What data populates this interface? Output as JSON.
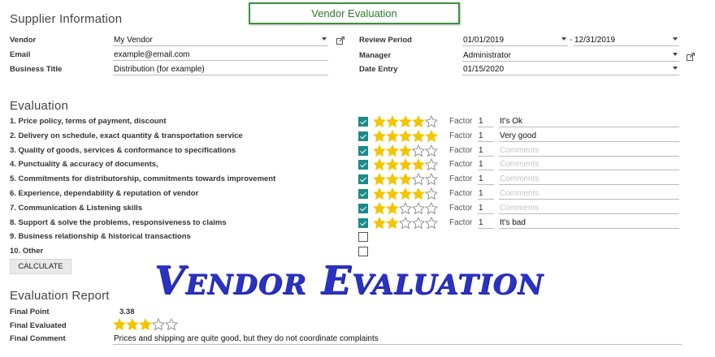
{
  "header": {
    "vendor_evaluation_button": "Vendor Evaluation"
  },
  "supplier": {
    "title": "Supplier Information",
    "vendor_label": "Vendor",
    "vendor_value": "My Vendor",
    "email_label": "Email",
    "email_value": "example@email.com",
    "business_title_label": "Business Title",
    "business_title_value": "Distribution (for example)"
  },
  "period": {
    "review_period_label": "Review Period",
    "start": "01/01/2019",
    "separator": "-",
    "end": "12/31/2019",
    "manager_label": "Manager",
    "manager_value": "Administrator",
    "date_entry_label": "Date Entry",
    "date_entry_value": "01/15/2020"
  },
  "evaluation": {
    "title": "Evaluation",
    "factor_label": "Factor",
    "max_stars": 5,
    "colors": {
      "star_filled": "#f2c500",
      "star_empty": "#888888",
      "checkbox": "#1c8a8a"
    },
    "criteria": [
      {
        "label": "1. Price policy, terms of payment, discount",
        "checked": true,
        "stars": 4,
        "factor": "1",
        "comment": "It's Ok",
        "placeholder": ""
      },
      {
        "label": "2. Delivery on schedule, exact quantity & transportation service",
        "checked": true,
        "stars": 5,
        "factor": "1",
        "comment": "Very good",
        "placeholder": ""
      },
      {
        "label": "3. Quality of goods, services & conformance to specifications",
        "checked": true,
        "stars": 3,
        "factor": "1",
        "comment": "",
        "placeholder": "Comments"
      },
      {
        "label": "4. Punctuality & accuracy of documents,",
        "checked": true,
        "stars": 4,
        "factor": "1",
        "comment": "",
        "placeholder": "Comments"
      },
      {
        "label": "5. Commitments for distributorship, commitments towards improvement",
        "checked": true,
        "stars": 3,
        "factor": "1",
        "comment": "",
        "placeholder": "Comments"
      },
      {
        "label": "6. Experience, dependability & reputation of vendor",
        "checked": true,
        "stars": 4,
        "factor": "1",
        "comment": "",
        "placeholder": "Comments"
      },
      {
        "label": "7. Communication & Listening skills",
        "checked": true,
        "stars": 2,
        "factor": "1",
        "comment": "",
        "placeholder": "Comments"
      },
      {
        "label": "8. Support & solve the problems, responsiveness to claims",
        "checked": true,
        "stars": 2,
        "factor": "1",
        "comment": "It's bad",
        "placeholder": ""
      },
      {
        "label": "9. Business relationship & historical transactions",
        "checked": false
      },
      {
        "label": "10. Other",
        "checked": false
      }
    ],
    "calculate_button": "CALCULATE"
  },
  "report": {
    "title": "Evaluation Report",
    "final_point_label": "Final Point",
    "final_point_value": "3.38",
    "final_evaluated_label": "Final Evaluated",
    "final_evaluated_stars": 3,
    "final_comment_label": "Final Comment",
    "final_comment_value": "Prices and shipping are quite good, but they do not coordinate complaints"
  },
  "overlay": {
    "title": "Vendor Evaluation"
  }
}
